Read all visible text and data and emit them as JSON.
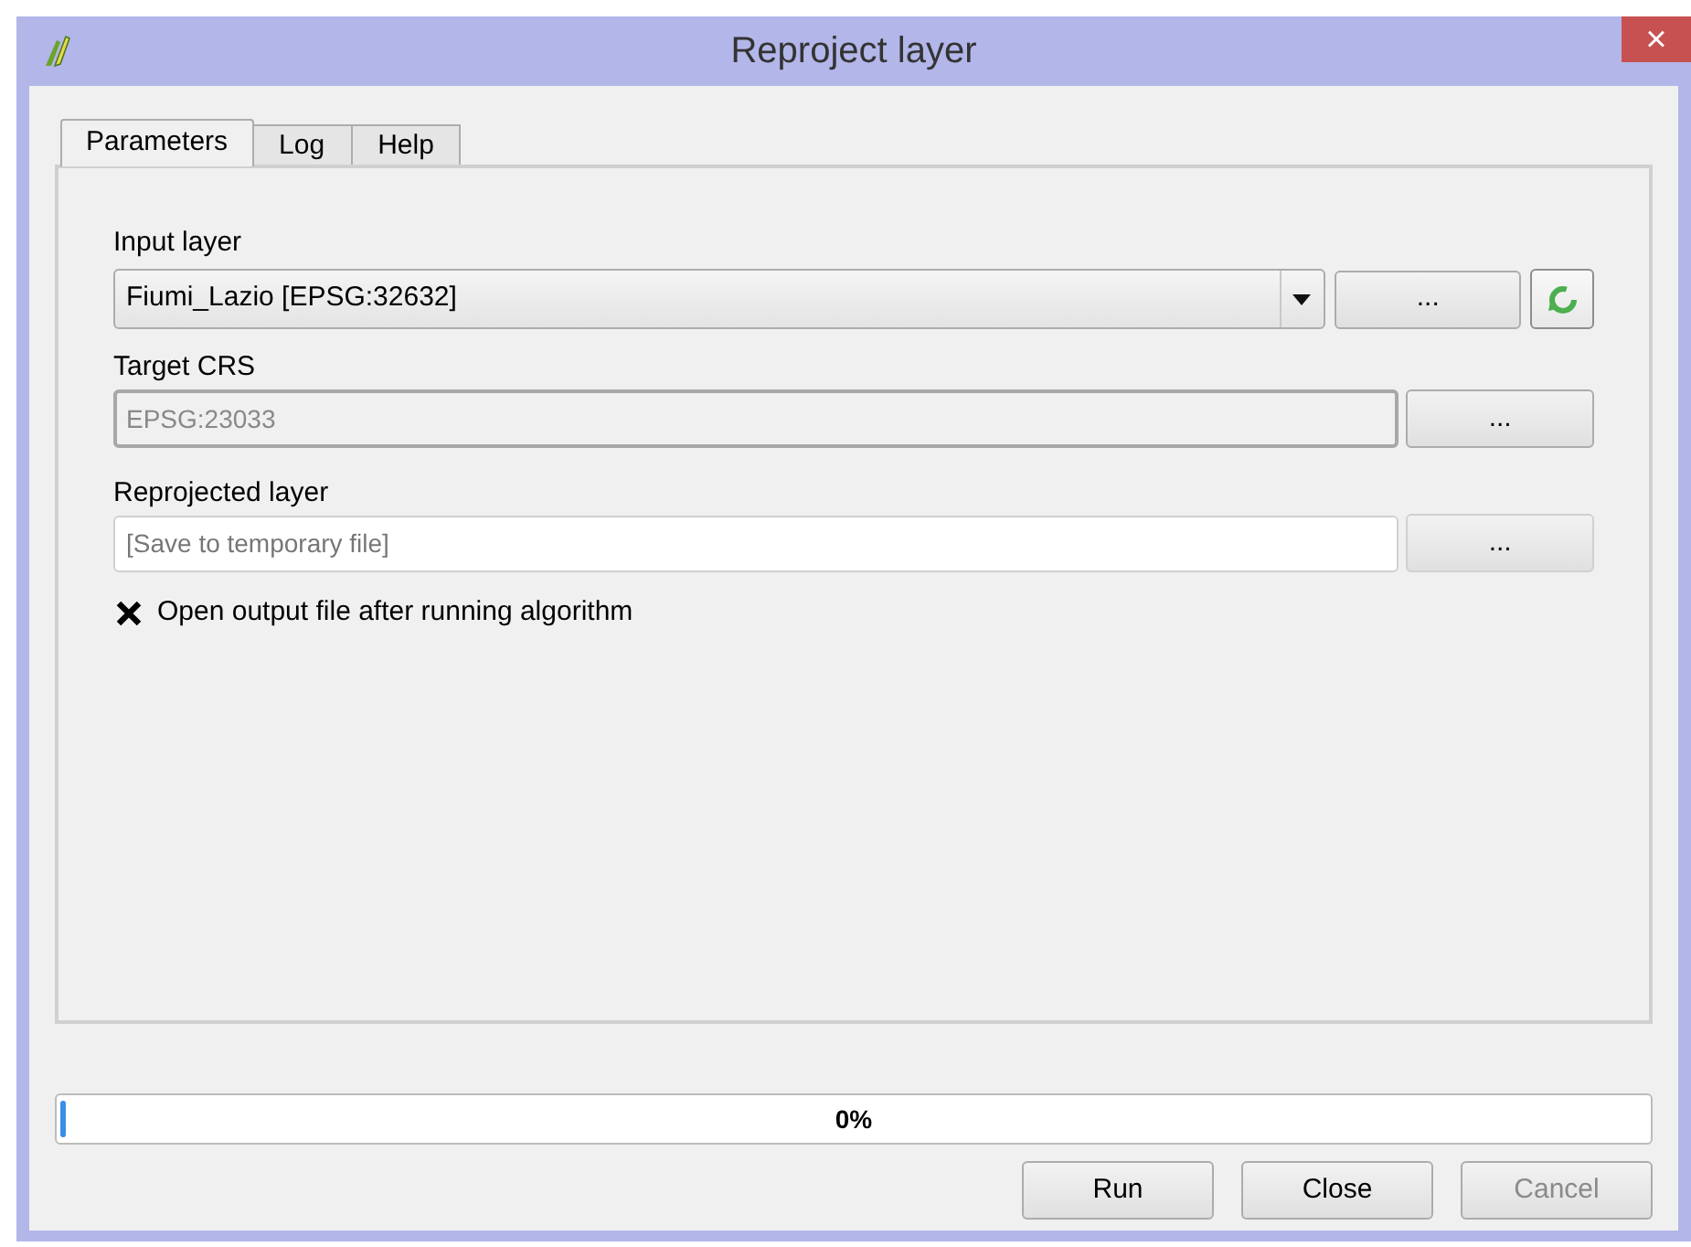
{
  "window": {
    "title": "Reproject layer",
    "close": "×"
  },
  "tabs": [
    {
      "label": "Parameters",
      "selected": true
    },
    {
      "label": "Log",
      "selected": false
    },
    {
      "label": "Help",
      "selected": false
    }
  ],
  "input_layer": {
    "label": "Input layer",
    "value": "Fiumi_Lazio [EPSG:32632]",
    "browse": "..."
  },
  "target_crs": {
    "label": "Target CRS",
    "value": "EPSG:23033",
    "disabled": true,
    "browse": "..."
  },
  "reprojected_layer": {
    "label": "Reprojected layer",
    "placeholder": "[Save to temporary file]",
    "browse": "..."
  },
  "open_output": {
    "label": "Open output file after running algorithm",
    "checked": true
  },
  "progress": {
    "level": 0,
    "reading": "0%"
  },
  "buttons": [
    {
      "label": "Run",
      "disabled": false
    },
    {
      "label": "Close",
      "disabled": false
    },
    {
      "label": "Cancel",
      "disabled": true
    }
  ]
}
